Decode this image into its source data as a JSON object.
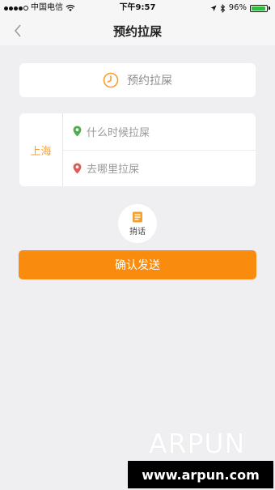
{
  "status_bar": {
    "carrier": "中国电信",
    "time": "下午9:57",
    "battery": "96%",
    "battery_level": 0.96,
    "signal_bars_filled": 4,
    "signal_bars_total": 5
  },
  "nav": {
    "title": "预约拉屎"
  },
  "booking": {
    "label": "预约拉屎"
  },
  "route": {
    "city": "上海",
    "time_placeholder": "什么时候拉屎",
    "destination_placeholder": "去哪里拉屎"
  },
  "message": {
    "label": "捎话"
  },
  "confirm": {
    "label": "确认发送"
  },
  "watermark": {
    "brand": "ARPUN",
    "url": "www.arpun.com"
  },
  "colors": {
    "accent": "#f98c0e",
    "city": "#f7a02e",
    "pin_green": "#4caf50",
    "pin_red": "#e05a5a",
    "background": "#efeff1"
  },
  "icons": {
    "back": "chevron-left-icon",
    "clock": "clock-icon",
    "pin_start": "location-pin-green-icon",
    "pin_end": "location-pin-red-icon",
    "message": "document-icon"
  }
}
